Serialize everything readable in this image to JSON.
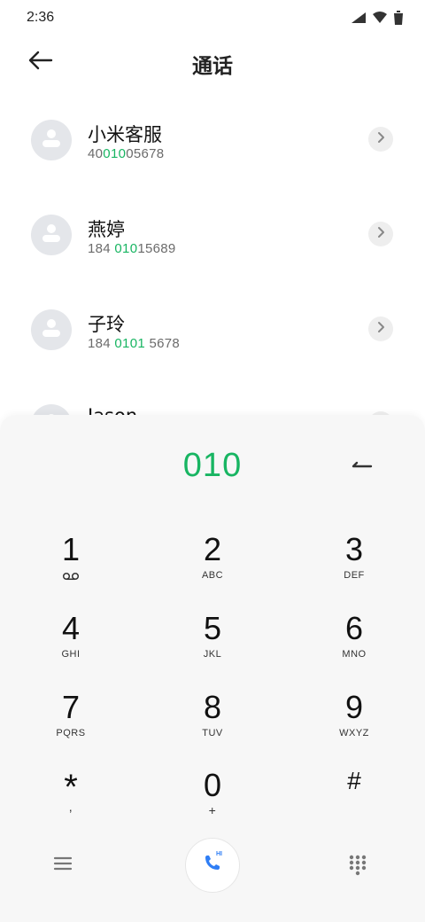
{
  "status_bar": {
    "time": "2:36",
    "icons": [
      "signal-icon",
      "wifi-icon",
      "battery-icon"
    ]
  },
  "app_bar": {
    "title": "通话",
    "back_icon": "arrow-left-icon"
  },
  "contacts": [
    {
      "name": "小米客服",
      "number_pre": "40",
      "number_match": "010",
      "number_post": "05678"
    },
    {
      "name": "燕婷",
      "number_pre": "184 ",
      "number_match": "010",
      "number_post": "15689"
    },
    {
      "name": "子玲",
      "number_pre": "184 ",
      "number_match": "0101",
      "number_post": " 5678"
    },
    {
      "name": "Jason",
      "number_pre": "",
      "number_match": "",
      "number_post": ""
    }
  ],
  "dialpad": {
    "input_value": "010",
    "keys": [
      {
        "digit": "1",
        "letters": ""
      },
      {
        "digit": "2",
        "letters": "ABC"
      },
      {
        "digit": "3",
        "letters": "DEF"
      },
      {
        "digit": "4",
        "letters": "GHI"
      },
      {
        "digit": "5",
        "letters": "JKL"
      },
      {
        "digit": "6",
        "letters": "MNO"
      },
      {
        "digit": "7",
        "letters": "PQRS"
      },
      {
        "digit": "8",
        "letters": "TUV"
      },
      {
        "digit": "9",
        "letters": "WXYZ"
      },
      {
        "digit": "*",
        "letters": ","
      },
      {
        "digit": "0",
        "letters": "+"
      },
      {
        "digit": "#",
        "letters": ""
      }
    ],
    "call_badge": "HI"
  },
  "colors": {
    "accent": "#18b562",
    "call_icon": "#2f7ef5"
  }
}
